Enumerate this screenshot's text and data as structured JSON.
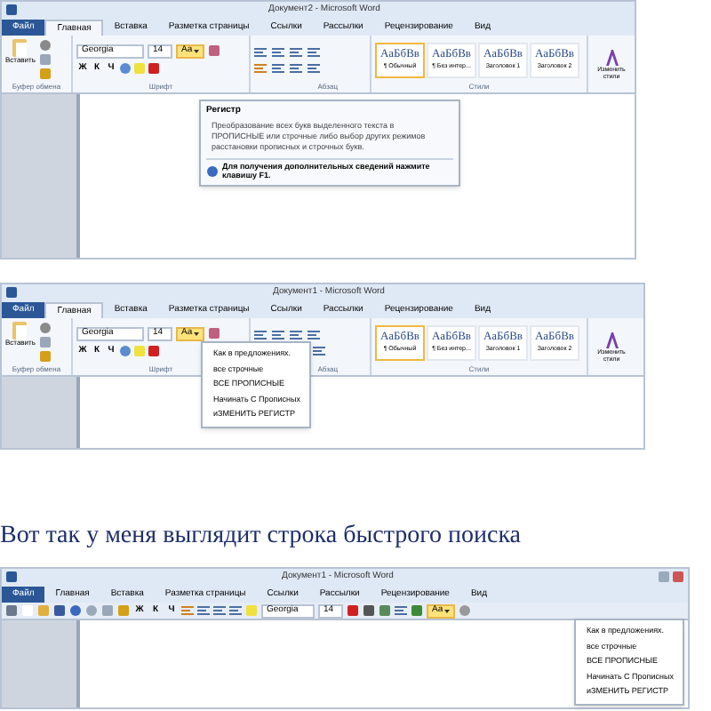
{
  "blocks": [
    {
      "kind": "window",
      "title": "Документ2 - Microsoft Word",
      "tabs": [
        {
          "label": "Файл",
          "selected": false,
          "kind": "file"
        },
        {
          "label": "Главная",
          "selected": true,
          "kind": "tab"
        },
        {
          "label": "Вставка",
          "selected": false,
          "kind": "tab"
        },
        {
          "label": "Разметка страницы",
          "selected": false,
          "kind": "tab"
        },
        {
          "label": "Ссылки",
          "selected": false,
          "kind": "tab"
        },
        {
          "label": "Рассылки",
          "selected": false,
          "kind": "tab"
        },
        {
          "label": "Рецензирование",
          "selected": false,
          "kind": "tab"
        },
        {
          "label": "Вид",
          "selected": false,
          "kind": "tab"
        }
      ],
      "ribbon": {
        "paste": "Вставить",
        "clipboard_label": "Буфер обмена",
        "font": "Georgia",
        "size": "14",
        "case_label": "Аа",
        "case_active": true,
        "format": [
          "Ж",
          "К",
          "Ч"
        ],
        "font_label": "Шрифт",
        "paragraph_label": "Абзац",
        "styles": [
          {
            "sample": "АаБбВв",
            "name": "¶ Обычный",
            "selected": true
          },
          {
            "sample": "АаБбВв",
            "name": "¶ Без интер...",
            "selected": false
          },
          {
            "sample": "АаБбВв",
            "name": "Заголовок 1",
            "selected": false
          },
          {
            "sample": "АаБбВв",
            "name": "Заголовок 2",
            "selected": false
          }
        ],
        "styles_label": "Стили",
        "change_styles": "Изменить стили"
      },
      "tooltip": {
        "title": "Регистр",
        "text": "Преобразование всех букв выделенного текста в ПРОПИСНЫЕ или строчные либо выбор других режимов расстановки прописных и строчных букв.",
        "help": "Для получения дополнительных сведений нажмите клавишу F1."
      }
    },
    {
      "kind": "window",
      "title": "Документ1 - Microsoft Word",
      "tabs": [
        {
          "label": "Файл",
          "selected": false,
          "kind": "file"
        },
        {
          "label": "Главная",
          "selected": true,
          "kind": "tab"
        },
        {
          "label": "Вставка",
          "selected": false,
          "kind": "tab"
        },
        {
          "label": "Разметка страницы",
          "selected": false,
          "kind": "tab"
        },
        {
          "label": "Ссылки",
          "selected": false,
          "kind": "tab"
        },
        {
          "label": "Рассылки",
          "selected": false,
          "kind": "tab"
        },
        {
          "label": "Рецензирование",
          "selected": false,
          "kind": "tab"
        },
        {
          "label": "Вид",
          "selected": false,
          "kind": "tab"
        }
      ],
      "ribbon": {
        "paste": "Вставить",
        "clipboard_label": "Буфер обмена",
        "font": "Georgia",
        "size": "14",
        "case_label": "Аа",
        "case_active": true,
        "format": [
          "Ж",
          "К",
          "Ч"
        ],
        "font_label": "Шрифт",
        "paragraph_label": "Абзац",
        "styles": [
          {
            "sample": "АаБбВв",
            "name": "¶ Обычный",
            "selected": true
          },
          {
            "sample": "АаБбВв",
            "name": "¶ Без интер...",
            "selected": false
          },
          {
            "sample": "АаБбВв",
            "name": "Заголовок 1",
            "selected": false
          },
          {
            "sample": "АаБбВв",
            "name": "Заголовок 2",
            "selected": false
          }
        ],
        "styles_label": "Стили",
        "change_styles": "Изменить стили"
      },
      "case_menu": [
        "Как в предложениях.",
        "все строчные",
        "ВСЕ ПРОПИСНЫЕ",
        "Начинать С Прописных",
        "иЗМЕНИТЬ РЕГИСТР"
      ]
    },
    {
      "kind": "caption",
      "text": "Вот так у меня выглядит строка быстрого поиска"
    },
    {
      "kind": "window",
      "title": "Документ1 - Microsoft Word",
      "tabs": [
        {
          "label": "Файл",
          "selected": false,
          "kind": "file"
        },
        {
          "label": "Главная",
          "selected": false,
          "kind": "tab"
        },
        {
          "label": "Вставка",
          "selected": false,
          "kind": "tab"
        },
        {
          "label": "Разметка страницы",
          "selected": false,
          "kind": "tab"
        },
        {
          "label": "Ссылки",
          "selected": false,
          "kind": "tab"
        },
        {
          "label": "Рассылки",
          "selected": false,
          "kind": "tab"
        },
        {
          "label": "Рецензирование",
          "selected": false,
          "kind": "tab"
        },
        {
          "label": "Вид",
          "selected": false,
          "kind": "tab"
        }
      ],
      "quick_toolbar": {
        "format": [
          "Ж",
          "К",
          "Ч"
        ],
        "font": "Georgia",
        "size": "14",
        "case_label": "Аа",
        "case_active": true
      },
      "case_menu": [
        "Как в предложениях.",
        "все строчные",
        "ВСЕ ПРОПИСНЫЕ",
        "Начинать С Прописных",
        "иЗМЕНИТЬ РЕГИСТР"
      ]
    }
  ]
}
